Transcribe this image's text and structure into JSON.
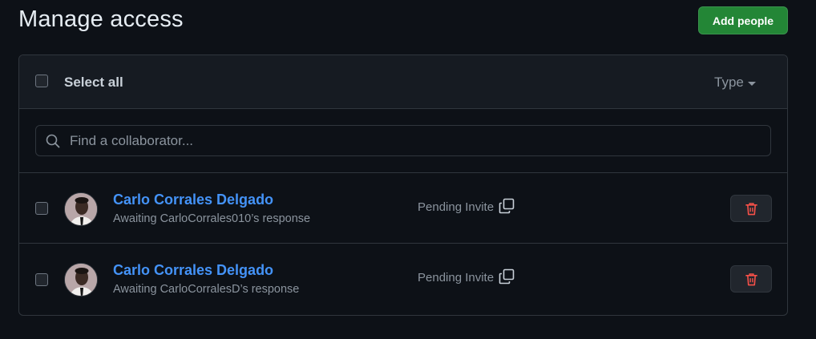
{
  "header": {
    "title": "Manage access",
    "add_button_label": "Add people"
  },
  "panel": {
    "select_all_label": "Select all",
    "type_filter_label": "Type",
    "search": {
      "placeholder": "Find a collaborator...",
      "value": ""
    },
    "members": [
      {
        "name": "Carlo Corrales Delgado",
        "status": "Awaiting CarloCorrales010’s response",
        "role_label": "Pending Invite"
      },
      {
        "name": "Carlo Corrales Delgado",
        "status": "Awaiting CarloCorralesD’s response",
        "role_label": "Pending Invite"
      }
    ]
  },
  "colors": {
    "background": "#0d1117",
    "panel_header": "#161b22",
    "border": "#30363d",
    "primary_button": "#238636",
    "link": "#4493f8",
    "danger": "#f85149",
    "muted_text": "#8b949e"
  },
  "icons": {
    "search": "search-icon",
    "caret": "chevron-down-icon",
    "copy": "copy-icon",
    "delete": "trash-icon"
  }
}
